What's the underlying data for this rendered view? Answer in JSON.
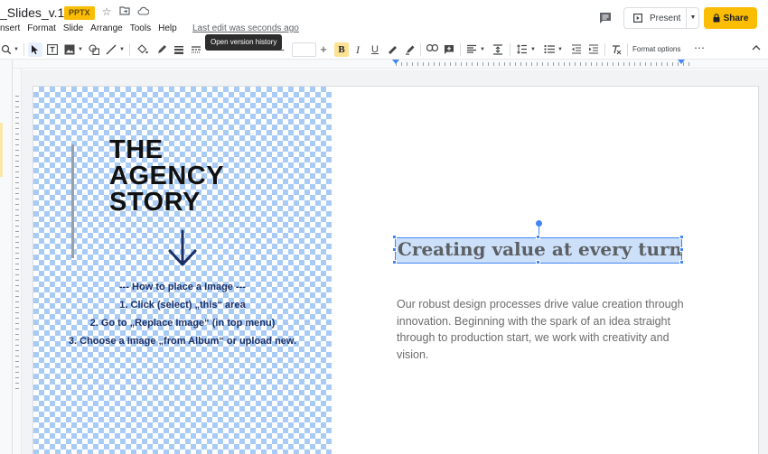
{
  "titlebar": {
    "doc_title": "_Slides_v.1.0",
    "format_badge": "PPTX",
    "last_edit": "Last edit was seconds ago",
    "tooltip": "Open version history"
  },
  "menu": {
    "items": [
      "nsert",
      "Format",
      "Slide",
      "Arrange",
      "Tools",
      "Help"
    ]
  },
  "actions": {
    "present_label": "Present",
    "share_label": "Share"
  },
  "toolbar": {
    "bold": "B",
    "italic": "I",
    "underline": "U",
    "format_options": "Format options",
    "more": "⋯"
  },
  "slide": {
    "title_lines": [
      "THE",
      "AGENCY",
      "STORY"
    ],
    "instructions": [
      "--- How to place a Image ---",
      "1. Click (select) „this“ area",
      "2. Go to „Replace Image“ (in top menu)",
      "3. Choose a Image „from Album“ or upload new."
    ],
    "heading": "Creating value at every turn",
    "body": "Our robust design processes drive value creation through innovation. Beginning with the spark of an idea straight through to production start, we work with creativity and vision."
  },
  "colors": {
    "accent_yellow": "#fbbc04",
    "selection_blue": "#4285f4",
    "placeholder_blue": "#a8cbf5",
    "instruction_text": "#1a2f66"
  }
}
